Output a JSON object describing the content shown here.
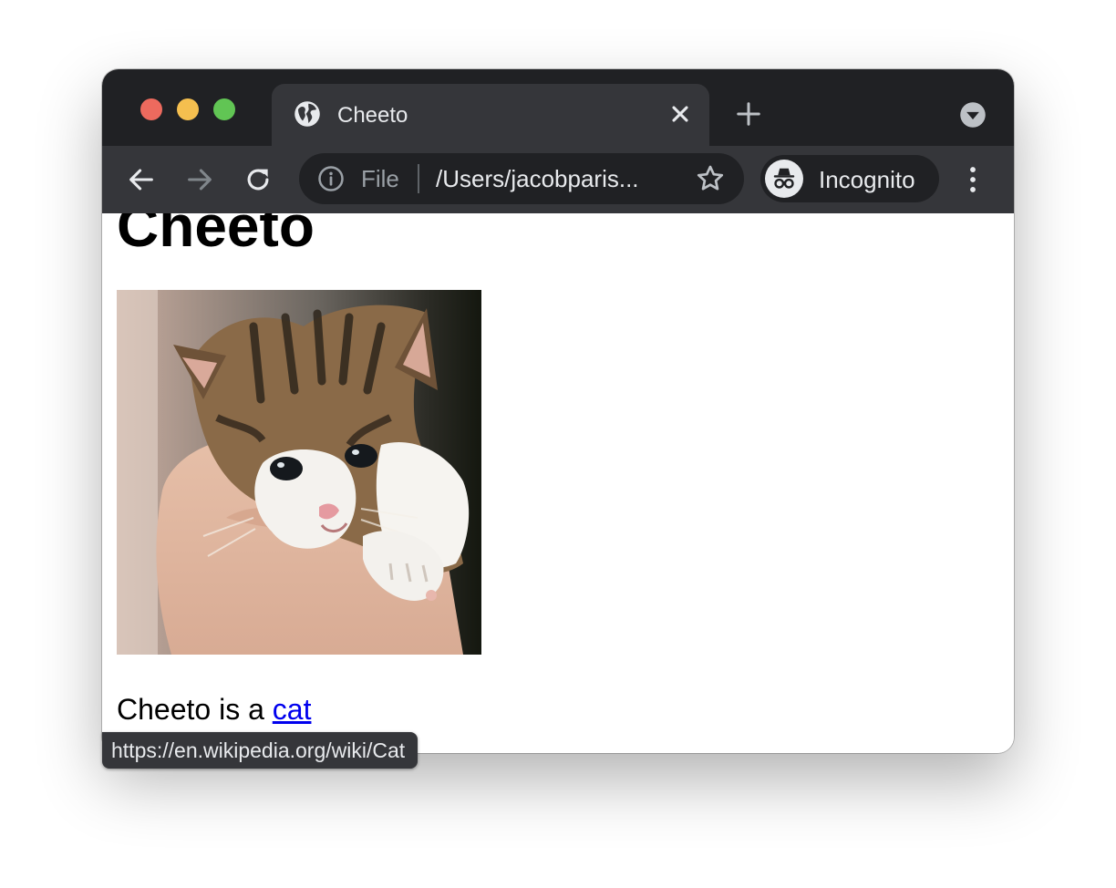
{
  "tab": {
    "title": "Cheeto"
  },
  "omnibox": {
    "scheme_label": "File",
    "url": "/Users/jacobparis..."
  },
  "profile": {
    "label": "Incognito"
  },
  "page": {
    "heading": "Cheeto",
    "paragraph_text": "Cheeto is a ",
    "link_text": "cat"
  },
  "status_bar": {
    "url": "https://en.wikipedia.org/wiki/Cat"
  },
  "icons": {
    "tab_favicon": "globe-icon",
    "close": "close-icon",
    "new_tab": "plus-icon",
    "tab_search": "chevron-down-icon",
    "back": "back-arrow-icon",
    "forward": "forward-arrow-icon",
    "reload": "reload-icon",
    "site_info": "info-icon",
    "bookmark": "star-icon",
    "incognito": "incognito-icon",
    "menu": "kebab-menu-icon"
  },
  "colors": {
    "tab_strip": "#202124",
    "toolbar": "#35363a",
    "link": "#0000ee"
  }
}
